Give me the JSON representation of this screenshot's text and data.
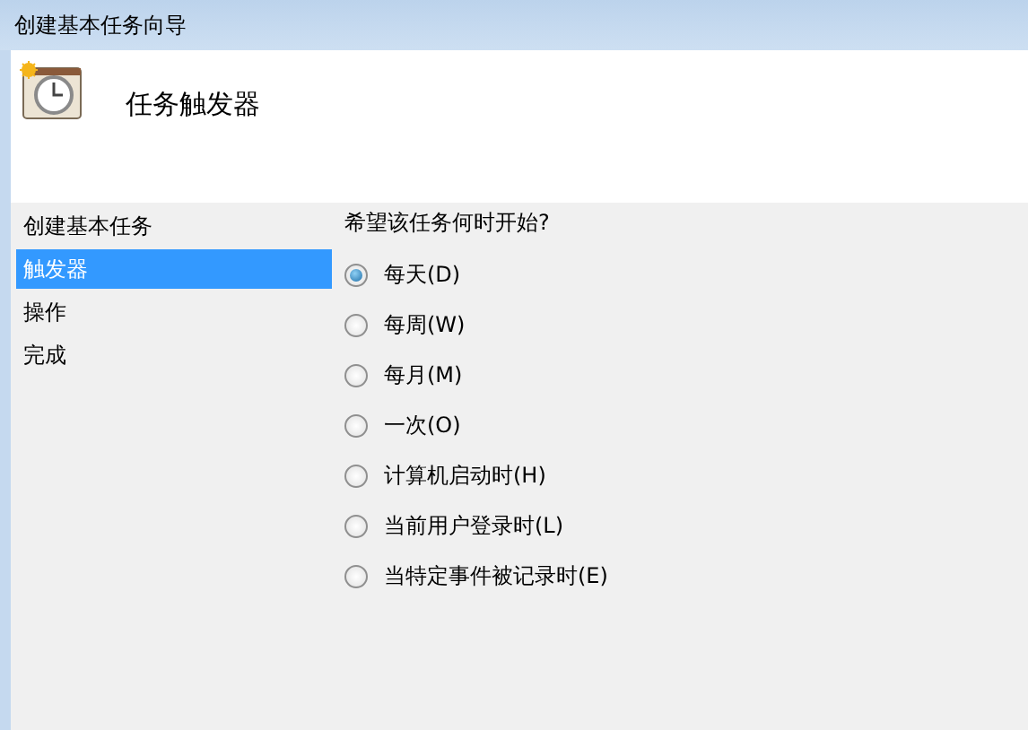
{
  "window": {
    "title": "创建基本任务向导"
  },
  "header": {
    "title": "任务触发器"
  },
  "sidebar": {
    "items": [
      {
        "label": "创建基本任务",
        "selected": false
      },
      {
        "label": "触发器",
        "selected": true
      },
      {
        "label": "操作",
        "selected": false
      },
      {
        "label": "完成",
        "selected": false
      }
    ]
  },
  "content": {
    "question": "希望该任务何时开始?",
    "options": [
      {
        "label": "每天(D)",
        "selected": true
      },
      {
        "label": "每周(W)",
        "selected": false
      },
      {
        "label": "每月(M)",
        "selected": false
      },
      {
        "label": "一次(O)",
        "selected": false
      },
      {
        "label": "计算机启动时(H)",
        "selected": false
      },
      {
        "label": "当前用户登录时(L)",
        "selected": false
      },
      {
        "label": "当特定事件被记录时(E)",
        "selected": false
      }
    ]
  }
}
